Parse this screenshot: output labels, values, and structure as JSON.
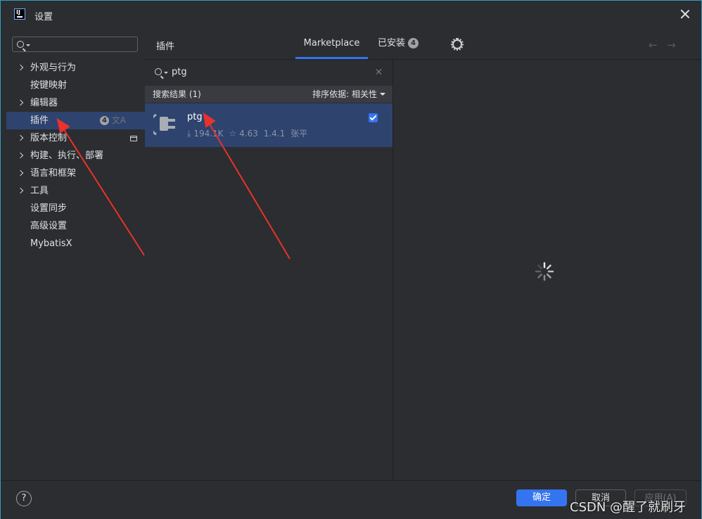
{
  "window": {
    "title": "设置",
    "app_icon_text": "IJ"
  },
  "sidebar": {
    "search_value": "",
    "items": [
      {
        "label": "外观与行为",
        "expandable": true
      },
      {
        "label": "按键映射",
        "expandable": false
      },
      {
        "label": "编辑器",
        "expandable": true
      },
      {
        "label": "插件",
        "expandable": false,
        "selected": true,
        "badge": "4"
      },
      {
        "label": "版本控制",
        "expandable": true
      },
      {
        "label": "构建、执行、部署",
        "expandable": true
      },
      {
        "label": "语言和框架",
        "expandable": true
      },
      {
        "label": "工具",
        "expandable": true
      },
      {
        "label": "设置同步",
        "expandable": false
      },
      {
        "label": "高级设置",
        "expandable": false
      },
      {
        "label": "MybatisX",
        "expandable": false
      }
    ]
  },
  "main": {
    "section_title": "插件",
    "tabs": [
      {
        "label": "Marketplace",
        "active": true
      },
      {
        "label": "已安装",
        "badge": "4"
      }
    ],
    "search": {
      "value": "ptg"
    },
    "results_label": "搜索结果 (1)",
    "sort_label": "排序依据: 相关性",
    "plugin": {
      "name": "ptg",
      "downloads": "194.1K",
      "rating": "4.63",
      "version": "1.4.1",
      "vendor": "张平",
      "checked": true
    }
  },
  "footer": {
    "help_label": "?",
    "ok_label": "确定",
    "cancel_label": "取消",
    "apply_label": "应用(A)"
  },
  "watermark": "CSDN @醒了就刷牙",
  "colors": {
    "accent": "#3574f0",
    "selection": "#2e436e",
    "annotation_arrow": "#e8322b"
  }
}
